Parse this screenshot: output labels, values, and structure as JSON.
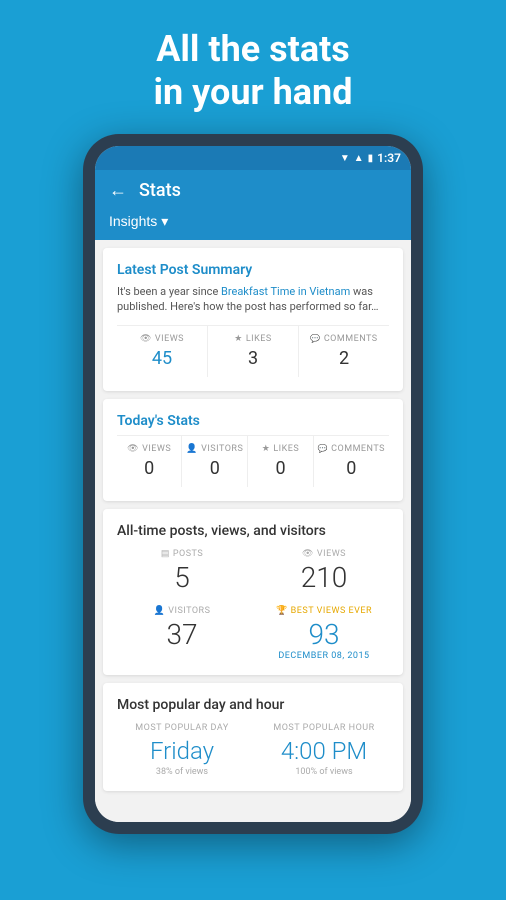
{
  "hero": {
    "line1": "All the stats",
    "line2": "in your hand"
  },
  "statusBar": {
    "time": "1:37"
  },
  "topBar": {
    "title": "Stats",
    "backLabel": "←"
  },
  "tabBar": {
    "label": "Insights",
    "dropdownArrow": "▾"
  },
  "latestPost": {
    "title": "Latest Post Summary",
    "descBefore": "It's been a year since ",
    "link": "Breakfast Time in Vietnam",
    "descAfter": " was published. Here's how the post has performed so far…",
    "views": {
      "label": "VIEWS",
      "value": "45"
    },
    "likes": {
      "label": "LIKES",
      "value": "3"
    },
    "comments": {
      "label": "COMMENTS",
      "value": "2"
    }
  },
  "todayStats": {
    "title": "Today's Stats",
    "views": {
      "label": "VIEWS",
      "value": "0"
    },
    "visitors": {
      "label": "VISITORS",
      "value": "0"
    },
    "likes": {
      "label": "LIKES",
      "value": "0"
    },
    "comments": {
      "label": "COMMENTS",
      "value": "0"
    }
  },
  "allTime": {
    "title": "All-time posts, views, and visitors",
    "posts": {
      "label": "POSTS",
      "value": "5"
    },
    "views": {
      "label": "VIEWS",
      "value": "210"
    },
    "visitors": {
      "label": "VISITORS",
      "value": "37"
    },
    "bestViews": {
      "label": "BEST VIEWS EVER",
      "value": "93",
      "date": "DECEMBER 08, 2015"
    }
  },
  "popular": {
    "title": "Most popular day and hour",
    "dayLabel": "MOST POPULAR DAY",
    "dayValue": "Friday",
    "daySub": "38% of views",
    "hourLabel": "MOST POPULAR HOUR",
    "hourValue": "4:00 PM",
    "hourSub": "100% of views"
  }
}
